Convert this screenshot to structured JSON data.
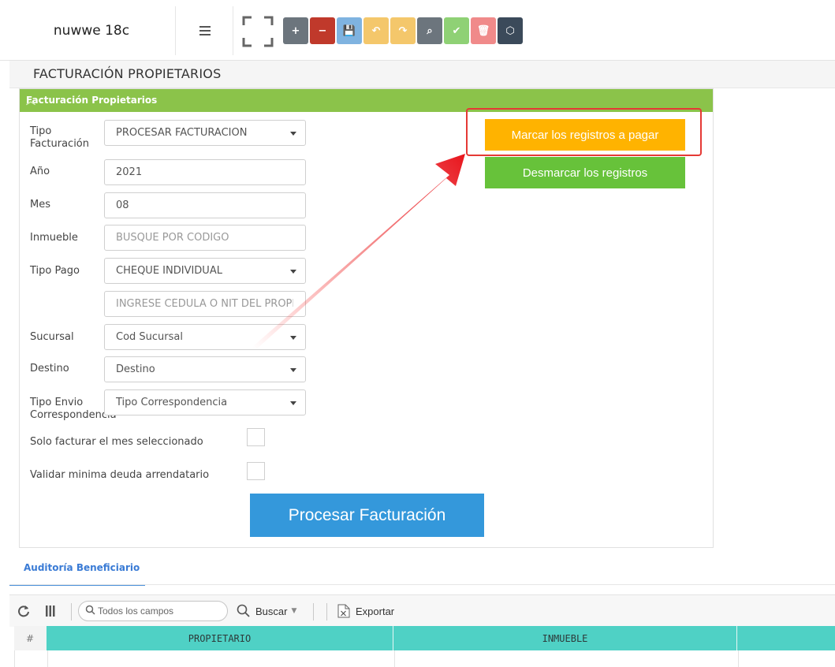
{
  "header": {
    "company_name": "nuwwe 18c"
  },
  "toolbar": {
    "buttons": [
      {
        "name": "add-button",
        "icon": "plus-icon",
        "glyph": "+",
        "color": "#6c757d"
      },
      {
        "name": "remove-button",
        "icon": "minus-icon",
        "glyph": "−",
        "color": "#c0392b"
      },
      {
        "name": "save-button",
        "icon": "floppy-icon",
        "glyph": "💾",
        "color": "#7fb3e0"
      },
      {
        "name": "undo-button",
        "icon": "undo-icon",
        "glyph": "↶",
        "color": "#f4c76b"
      },
      {
        "name": "redo-button",
        "icon": "redo-icon",
        "glyph": "↷",
        "color": "#f4c76b"
      },
      {
        "name": "search-button",
        "icon": "magnifier-icon",
        "glyph": "⌕",
        "color": "#6c757d"
      },
      {
        "name": "confirm-button",
        "icon": "check-icon",
        "glyph": "✔",
        "color": "#8fd175"
      },
      {
        "name": "delete-button",
        "icon": "trash-icon",
        "glyph": "🗑",
        "color": "#f08a8a"
      },
      {
        "name": "package-button",
        "icon": "cube-icon",
        "glyph": "⬡",
        "color": "#3b4a5a"
      }
    ]
  },
  "page": {
    "title": "FACTURACIÓN PROPIETARIOS"
  },
  "panel": {
    "title": "Facturación Propietarios",
    "fields": {
      "tipo_facturacion": {
        "label_1": "Tipo",
        "label_2": "Facturación",
        "value": "PROCESAR FACTURACIÓN"
      },
      "anio": {
        "label": "Año",
        "value": "2021"
      },
      "mes": {
        "label": "Mes",
        "value": "08"
      },
      "inmueble": {
        "label": "Inmueble",
        "placeholder": "BUSQUE POR CÓDIGO"
      },
      "tipo_pago": {
        "label": "Tipo Pago",
        "value": "CHEQUE INDIVIDUAL"
      },
      "cedula": {
        "placeholder": "INGRESE CÉDULA Ó NIT DEL PROPIETARIO"
      },
      "sucursal": {
        "label": "Sucursal",
        "value": "Cod Sucursal"
      },
      "destino": {
        "label": "Destino",
        "value": "Destino"
      },
      "tipo_envio": {
        "label_1": "Tipo Envio",
        "label_2": "Correspondencia",
        "value": "Tipo Correspondencia"
      }
    },
    "checkboxes": {
      "solo_mes": {
        "label": "Solo facturar el mes seleccionado",
        "checked": false
      },
      "validar_deuda": {
        "label": "Validar minima deuda arrendatario",
        "checked": false
      }
    },
    "buttons": {
      "mark": "Marcar los registros a pagar",
      "unmark": "Desmarcar los registros",
      "process": "Procesar Facturación"
    }
  },
  "tabs": {
    "active": "Auditoría Beneficiario"
  },
  "grid": {
    "search_placeholder": "Todos los campos",
    "search_label": "Buscar",
    "export_label": "Exportar",
    "columns": [
      "#",
      "PROPIETARIO",
      "INMUEBLE",
      ""
    ]
  },
  "colors": {
    "accent_green": "#8bc34a",
    "mark_button": "#ffb300",
    "unmark_button": "#67c23a",
    "process_button": "#3498db",
    "table_header": "#4fd1c5",
    "highlight_border": "#e53935"
  }
}
